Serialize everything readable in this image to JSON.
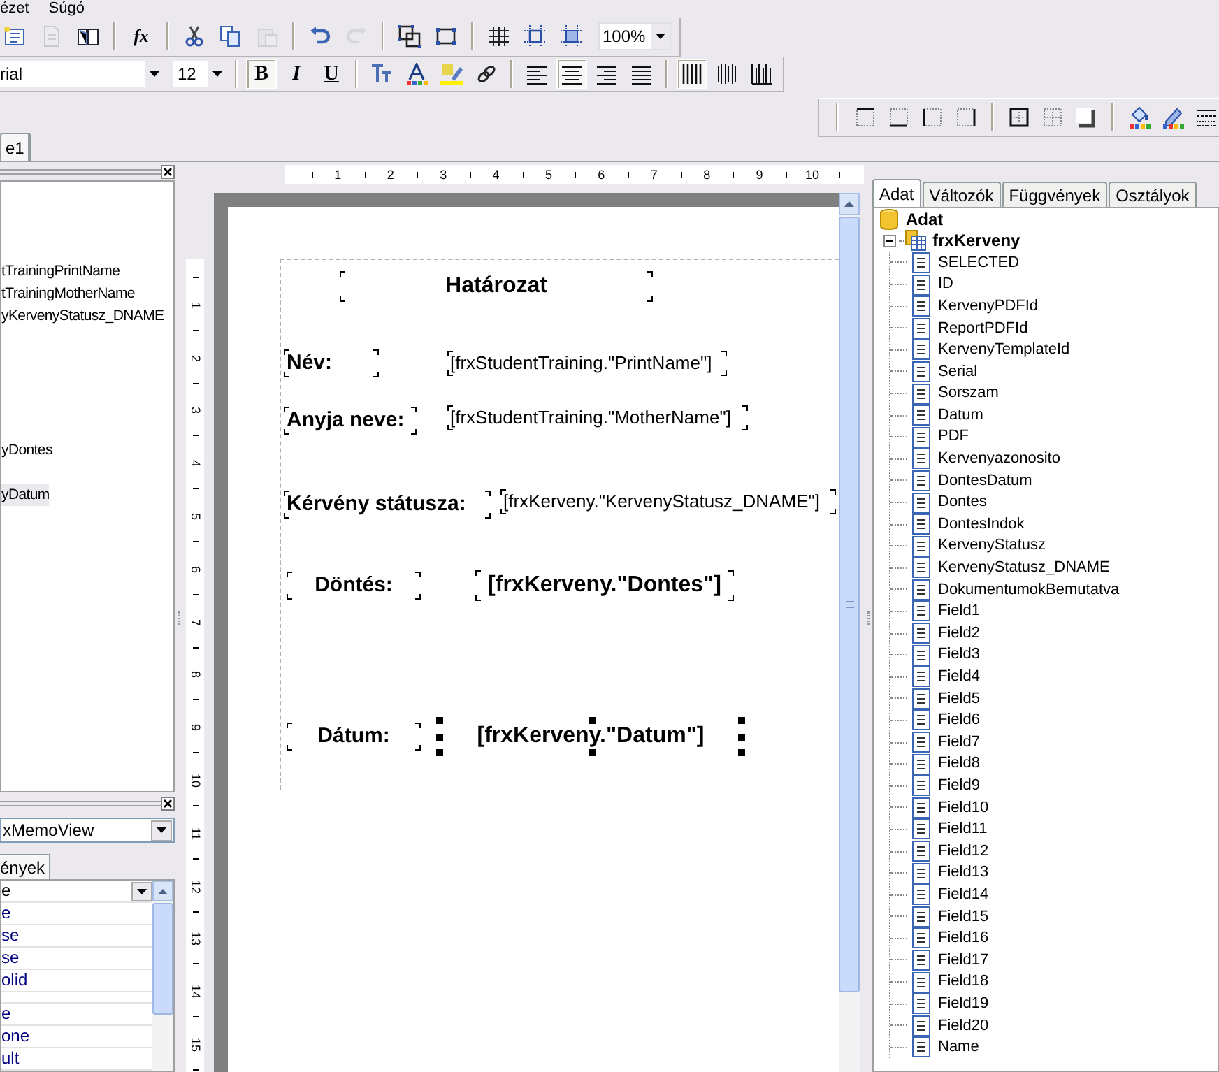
{
  "menu": [
    "ézet",
    "Súgó"
  ],
  "toolbar_standard": [
    {
      "kind": "report-new",
      "disabled": false
    },
    {
      "kind": "page",
      "disabled": true
    },
    {
      "kind": "book",
      "disabled": false
    },
    {
      "kind": "separator"
    },
    {
      "kind": "function",
      "label": "fx",
      "disabled": false
    },
    {
      "kind": "separator"
    },
    {
      "kind": "cut",
      "disabled": false
    },
    {
      "kind": "copy",
      "disabled": false
    },
    {
      "kind": "paste",
      "disabled": true
    },
    {
      "kind": "separator"
    },
    {
      "kind": "undo",
      "disabled": false
    },
    {
      "kind": "redo",
      "disabled": true
    },
    {
      "kind": "separator"
    },
    {
      "kind": "group",
      "disabled": false
    },
    {
      "kind": "ungroup",
      "disabled": false
    },
    {
      "kind": "separator"
    },
    {
      "kind": "grid",
      "disabled": false
    },
    {
      "kind": "fit-grid",
      "disabled": false
    },
    {
      "kind": "align-grid",
      "disabled": false
    }
  ],
  "zoom": "100%",
  "toolbar_format": {
    "font": "rial",
    "size": "12",
    "buttons": [
      {
        "kind": "separator"
      },
      {
        "kind": "bold",
        "label": "B",
        "pressed": true
      },
      {
        "kind": "italic",
        "label": "I",
        "pressed": false
      },
      {
        "kind": "underline",
        "label": "U",
        "pressed": false
      },
      {
        "kind": "separator"
      },
      {
        "kind": "text-style",
        "pressed": false
      },
      {
        "kind": "font-color",
        "pressed": false
      },
      {
        "kind": "highlight",
        "pressed": false
      },
      {
        "kind": "rotate",
        "pressed": false
      },
      {
        "kind": "separator"
      },
      {
        "kind": "align-left",
        "pressed": false
      },
      {
        "kind": "align-center",
        "pressed": true
      },
      {
        "kind": "align-right",
        "pressed": false
      },
      {
        "kind": "justify",
        "pressed": false
      },
      {
        "kind": "separator"
      },
      {
        "kind": "bars-wide",
        "pressed": true
      },
      {
        "kind": "bars-mid",
        "pressed": false
      },
      {
        "kind": "bars-narrow",
        "pressed": false
      }
    ]
  },
  "toolbar_border": [
    {
      "kind": "frame-top"
    },
    {
      "kind": "frame-bottom"
    },
    {
      "kind": "frame-left"
    },
    {
      "kind": "frame-right"
    },
    {
      "kind": "separator"
    },
    {
      "kind": "frame-all"
    },
    {
      "kind": "frame-none"
    },
    {
      "kind": "shadow"
    },
    {
      "kind": "separator"
    },
    {
      "kind": "fill-color"
    },
    {
      "kind": "line-color"
    },
    {
      "kind": "line-style"
    }
  ],
  "page_tabs": [
    {
      "label": "e1",
      "selected": true
    }
  ],
  "report_tree": {
    "rows": [
      {},
      {},
      {},
      {
        "text": "tTrainingPrintName",
        "selected": false
      },
      {
        "text": "tTrainingMotherName",
        "selected": false
      },
      {
        "text": "yKervenyStatusz_DNAME",
        "selected": false
      },
      {},
      {},
      {},
      {},
      {},
      {
        "text": "yDontes",
        "selected": false
      },
      {},
      {
        "text": "yDatum",
        "selected": true
      }
    ]
  },
  "object_inspector": {
    "object": "xMemoView",
    "tabs": [
      {
        "label": "ények",
        "selected": true
      }
    ],
    "rows": [
      {
        "value": "e",
        "kind": "dropdown"
      },
      {
        "value": "e"
      },
      {
        "value": "se"
      },
      {
        "value": "se"
      },
      {
        "value": "olid"
      },
      {},
      {
        "value": "e"
      },
      {
        "value": "one"
      },
      {
        "value": "ult"
      }
    ]
  },
  "ruler_horizontal": [
    "1",
    "2",
    "3",
    "4",
    "5",
    "6",
    "7",
    "8",
    "9",
    "10"
  ],
  "ruler_vertical": [
    "1",
    "2",
    "3",
    "4",
    "5",
    "6",
    "7",
    "8",
    "9",
    "10",
    "11",
    "12",
    "13",
    "14",
    "15"
  ],
  "report_objects": [
    {
      "text": "Határozat",
      "bold": true,
      "selected": false
    },
    {
      "text": "Név:",
      "bold": true,
      "selected": false
    },
    {
      "text": "[frxStudentTraining.\"PrintName\"]",
      "bold": false,
      "selected": false
    },
    {
      "text": "Anyja neve:",
      "bold": true,
      "selected": false
    },
    {
      "text": "[frxStudentTraining.\"MotherName\"]",
      "bold": false,
      "selected": false
    },
    {
      "text": "Kérvény státusza:",
      "bold": true,
      "selected": false
    },
    {
      "text": "[frxKerveny.\"KervenyStatusz_DNAME\"]",
      "bold": false,
      "selected": false
    },
    {
      "text": "Döntés:",
      "bold": true,
      "selected": false
    },
    {
      "text": "[frxKerveny.\"Dontes\"]",
      "bold": true,
      "selected": false
    },
    {
      "text": "Dátum:",
      "bold": true,
      "selected": false
    },
    {
      "text": "[frxKerveny.\"Datum\"]",
      "bold": true,
      "selected": true
    }
  ],
  "data_tabs": [
    {
      "label": "Adat",
      "selected": true
    },
    {
      "label": "Változók",
      "selected": false
    },
    {
      "label": "Függvények",
      "selected": false
    },
    {
      "label": "Osztályok",
      "selected": false
    }
  ],
  "data_tree": {
    "label": "Adat",
    "kind": "database",
    "children": [
      {
        "label": "frxKerveny",
        "kind": "table",
        "expanded": true,
        "children": [
          {
            "label": "SELECTED",
            "kind": "field"
          },
          {
            "label": "ID",
            "kind": "field"
          },
          {
            "label": "KervenyPDFId",
            "kind": "field"
          },
          {
            "label": "ReportPDFId",
            "kind": "field"
          },
          {
            "label": "KervenyTemplateId",
            "kind": "field"
          },
          {
            "label": "Serial",
            "kind": "field"
          },
          {
            "label": "Sorszam",
            "kind": "field"
          },
          {
            "label": "Datum",
            "kind": "field"
          },
          {
            "label": "PDF",
            "kind": "field"
          },
          {
            "label": "Kervenyazonosito",
            "kind": "field"
          },
          {
            "label": "DontesDatum",
            "kind": "field"
          },
          {
            "label": "Dontes",
            "kind": "field"
          },
          {
            "label": "DontesIndok",
            "kind": "field"
          },
          {
            "label": "KervenyStatusz",
            "kind": "field"
          },
          {
            "label": "KervenyStatusz_DNAME",
            "kind": "field"
          },
          {
            "label": "DokumentumokBemutatva",
            "kind": "field"
          },
          {
            "label": "Field1",
            "kind": "field"
          },
          {
            "label": "Field2",
            "kind": "field"
          },
          {
            "label": "Field3",
            "kind": "field"
          },
          {
            "label": "Field4",
            "kind": "field"
          },
          {
            "label": "Field5",
            "kind": "field"
          },
          {
            "label": "Field6",
            "kind": "field"
          },
          {
            "label": "Field7",
            "kind": "field"
          },
          {
            "label": "Field8",
            "kind": "field"
          },
          {
            "label": "Field9",
            "kind": "field"
          },
          {
            "label": "Field10",
            "kind": "field"
          },
          {
            "label": "Field11",
            "kind": "field"
          },
          {
            "label": "Field12",
            "kind": "field"
          },
          {
            "label": "Field13",
            "kind": "field"
          },
          {
            "label": "Field14",
            "kind": "field"
          },
          {
            "label": "Field15",
            "kind": "field"
          },
          {
            "label": "Field16",
            "kind": "field"
          },
          {
            "label": "Field17",
            "kind": "field"
          },
          {
            "label": "Field18",
            "kind": "field"
          },
          {
            "label": "Field19",
            "kind": "field"
          },
          {
            "label": "Field20",
            "kind": "field"
          },
          {
            "label": "Name",
            "kind": "field"
          }
        ]
      }
    ]
  }
}
